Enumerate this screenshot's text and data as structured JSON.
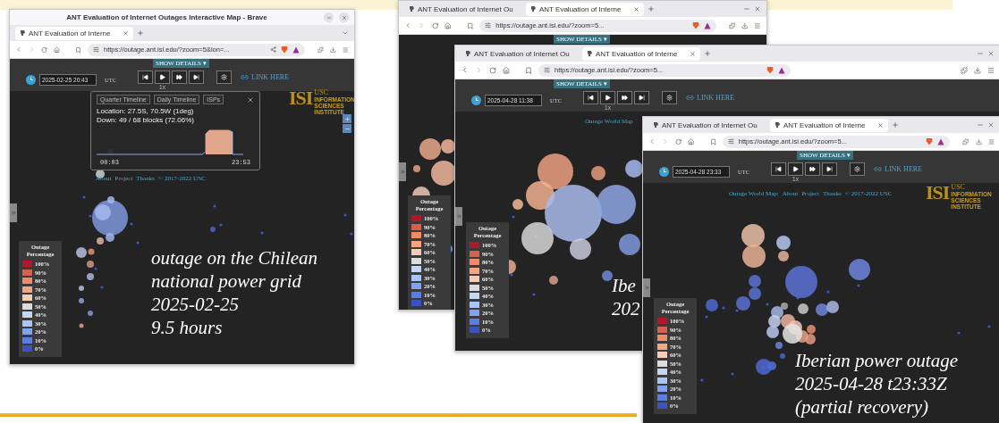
{
  "windows": [
    {
      "title": "ANT Evaluation of Internet Outages Interactive Map - Brave",
      "tabs": [
        {
          "label": "ANT Evaluation of Interne",
          "selected": true
        }
      ],
      "url": "https://outage.ant.isi.edu/?zoom=5&lon=...",
      "map": {
        "show_details": "SHOW DETAILS ▾",
        "toolbar": {
          "date": "2025-02-25 20:43",
          "timezone": "UTC",
          "speed": "1x",
          "link": "LINK HERE"
        },
        "popup": {
          "tabs": [
            "Quarter Timeline",
            "Daily Timeline",
            "ISPs"
          ],
          "location": "Location: 27.5S, 70.5W (1deg)",
          "down": "Down: 49 / 68 blocks (72.06%)",
          "start": "00:03",
          "end": "23:53"
        },
        "footer": {
          "links": [
            "About",
            "Project",
            "Thanks"
          ],
          "copyright": "© 2017-2022 USC"
        },
        "logo": {
          "mark": "ISI",
          "org": "USC",
          "lines": [
            "INFORMATION",
            "SCIENCES",
            "INSTITUTE"
          ]
        },
        "legend": {
          "title": "Outage Percentage",
          "items": [
            {
              "label": "100%",
              "color": "#b2182b"
            },
            {
              "label": "90%",
              "color": "#d6604d"
            },
            {
              "label": "80%",
              "color": "#f08a6a"
            },
            {
              "label": "70%",
              "color": "#f4a582"
            },
            {
              "label": "60%",
              "color": "#f6cdb8"
            },
            {
              "label": "50%",
              "color": "#dcdcdc"
            },
            {
              "label": "40%",
              "color": "#c4d6f4"
            },
            {
              "label": "30%",
              "color": "#a8c4f8"
            },
            {
              "label": "20%",
              "color": "#7fa3f0"
            },
            {
              "label": "10%",
              "color": "#5b7ee6"
            },
            {
              "label": "0%",
              "color": "#3a52c6"
            }
          ]
        },
        "caption": [
          "outage on the Chilean",
          "national power grid",
          "2025-02-25",
          "9.5 hours"
        ]
      }
    },
    {
      "tabs": [
        {
          "label": "ANT Evaluation of Internet Ou",
          "selected": false
        },
        {
          "label": "ANT Evaluation of Interne",
          "selected": true
        }
      ],
      "url": "https://outage.ant.isi.edu/?zoom=5...",
      "map": {
        "show_details": "SHOW DETAILS ▾",
        "legend": {
          "title": "Outage Percentage",
          "items": [
            {
              "label": "100%",
              "color": "#b2182b"
            },
            {
              "label": "90%",
              "color": "#d6604d"
            },
            {
              "label": "80%",
              "color": "#f08a6a"
            },
            {
              "label": "70%",
              "color": "#f4a582"
            },
            {
              "label": "60%",
              "color": "#f6cdb8"
            },
            {
              "label": "50%",
              "color": "#dcdcdc"
            },
            {
              "label": "40%",
              "color": "#c4d6f4"
            },
            {
              "label": "30%",
              "color": "#a8c4f8"
            },
            {
              "label": "20%",
              "color": "#7fa3f0"
            },
            {
              "label": "10%",
              "color": "#5b7ee6"
            },
            {
              "label": "0%",
              "color": "#3a52c6"
            }
          ]
        }
      }
    },
    {
      "tabs": [
        {
          "label": "ANT Evaluation of Internet Ou",
          "selected": false
        },
        {
          "label": "ANT Evaluation of Interne",
          "selected": true
        }
      ],
      "url": "https://outage.ant.isi.edu/?zoom=5...",
      "map": {
        "show_details": "SHOW DETAILS ▾",
        "toolbar": {
          "date": "2025-04-28 11:38",
          "timezone": "UTC",
          "speed": "1x",
          "link": "LINK HERE"
        },
        "footer": {
          "label": "Outage World Map"
        },
        "legend": {
          "title": "Outage Percentage",
          "items": [
            {
              "label": "100%",
              "color": "#b2182b"
            },
            {
              "label": "90%",
              "color": "#d6604d"
            },
            {
              "label": "80%",
              "color": "#f08a6a"
            },
            {
              "label": "70%",
              "color": "#f4a582"
            },
            {
              "label": "60%",
              "color": "#f6cdb8"
            },
            {
              "label": "50%",
              "color": "#dcdcdc"
            },
            {
              "label": "40%",
              "color": "#c4d6f4"
            },
            {
              "label": "30%",
              "color": "#a8c4f8"
            },
            {
              "label": "20%",
              "color": "#7fa3f0"
            },
            {
              "label": "10%",
              "color": "#5b7ee6"
            },
            {
              "label": "0%",
              "color": "#3a52c6"
            }
          ]
        },
        "caption": [
          "Ibe",
          "202"
        ]
      }
    },
    {
      "tabs": [
        {
          "label": "ANT Evaluation of Internet Ou",
          "selected": false
        },
        {
          "label": "ANT Evaluation of Interne",
          "selected": true
        }
      ],
      "url": "https://outage.ant.isi.edu/?zoom=5...",
      "map": {
        "show_details": "SHOW DETAILS ▾",
        "toolbar": {
          "date": "2025-04-28 23:33",
          "timezone": "UTC",
          "speed": "1x",
          "link": "LINK HERE"
        },
        "footer": {
          "label": "Outage World Map:",
          "links": [
            "About",
            "Project",
            "Thanks"
          ],
          "copyright": "© 2017-2022 USC"
        },
        "logo": {
          "mark": "ISI",
          "org": "USC",
          "lines": [
            "INFORMATION",
            "SCIENCES",
            "INSTITUTE"
          ]
        },
        "legend": {
          "title": "Outage Percentage",
          "items": [
            {
              "label": "100%",
              "color": "#b2182b"
            },
            {
              "label": "90%",
              "color": "#d6604d"
            },
            {
              "label": "80%",
              "color": "#f08a6a"
            },
            {
              "label": "70%",
              "color": "#f4a582"
            },
            {
              "label": "60%",
              "color": "#f6cdb8"
            },
            {
              "label": "50%",
              "color": "#dcdcdc"
            },
            {
              "label": "40%",
              "color": "#c4d6f4"
            },
            {
              "label": "30%",
              "color": "#a8c4f8"
            },
            {
              "label": "20%",
              "color": "#7fa3f0"
            },
            {
              "label": "10%",
              "color": "#5b7ee6"
            },
            {
              "label": "0%",
              "color": "#3a52c6"
            }
          ]
        },
        "caption": [
          "Iberian power outage",
          "2025-04-28 t23:33Z",
          "(partial recovery)"
        ]
      }
    }
  ]
}
